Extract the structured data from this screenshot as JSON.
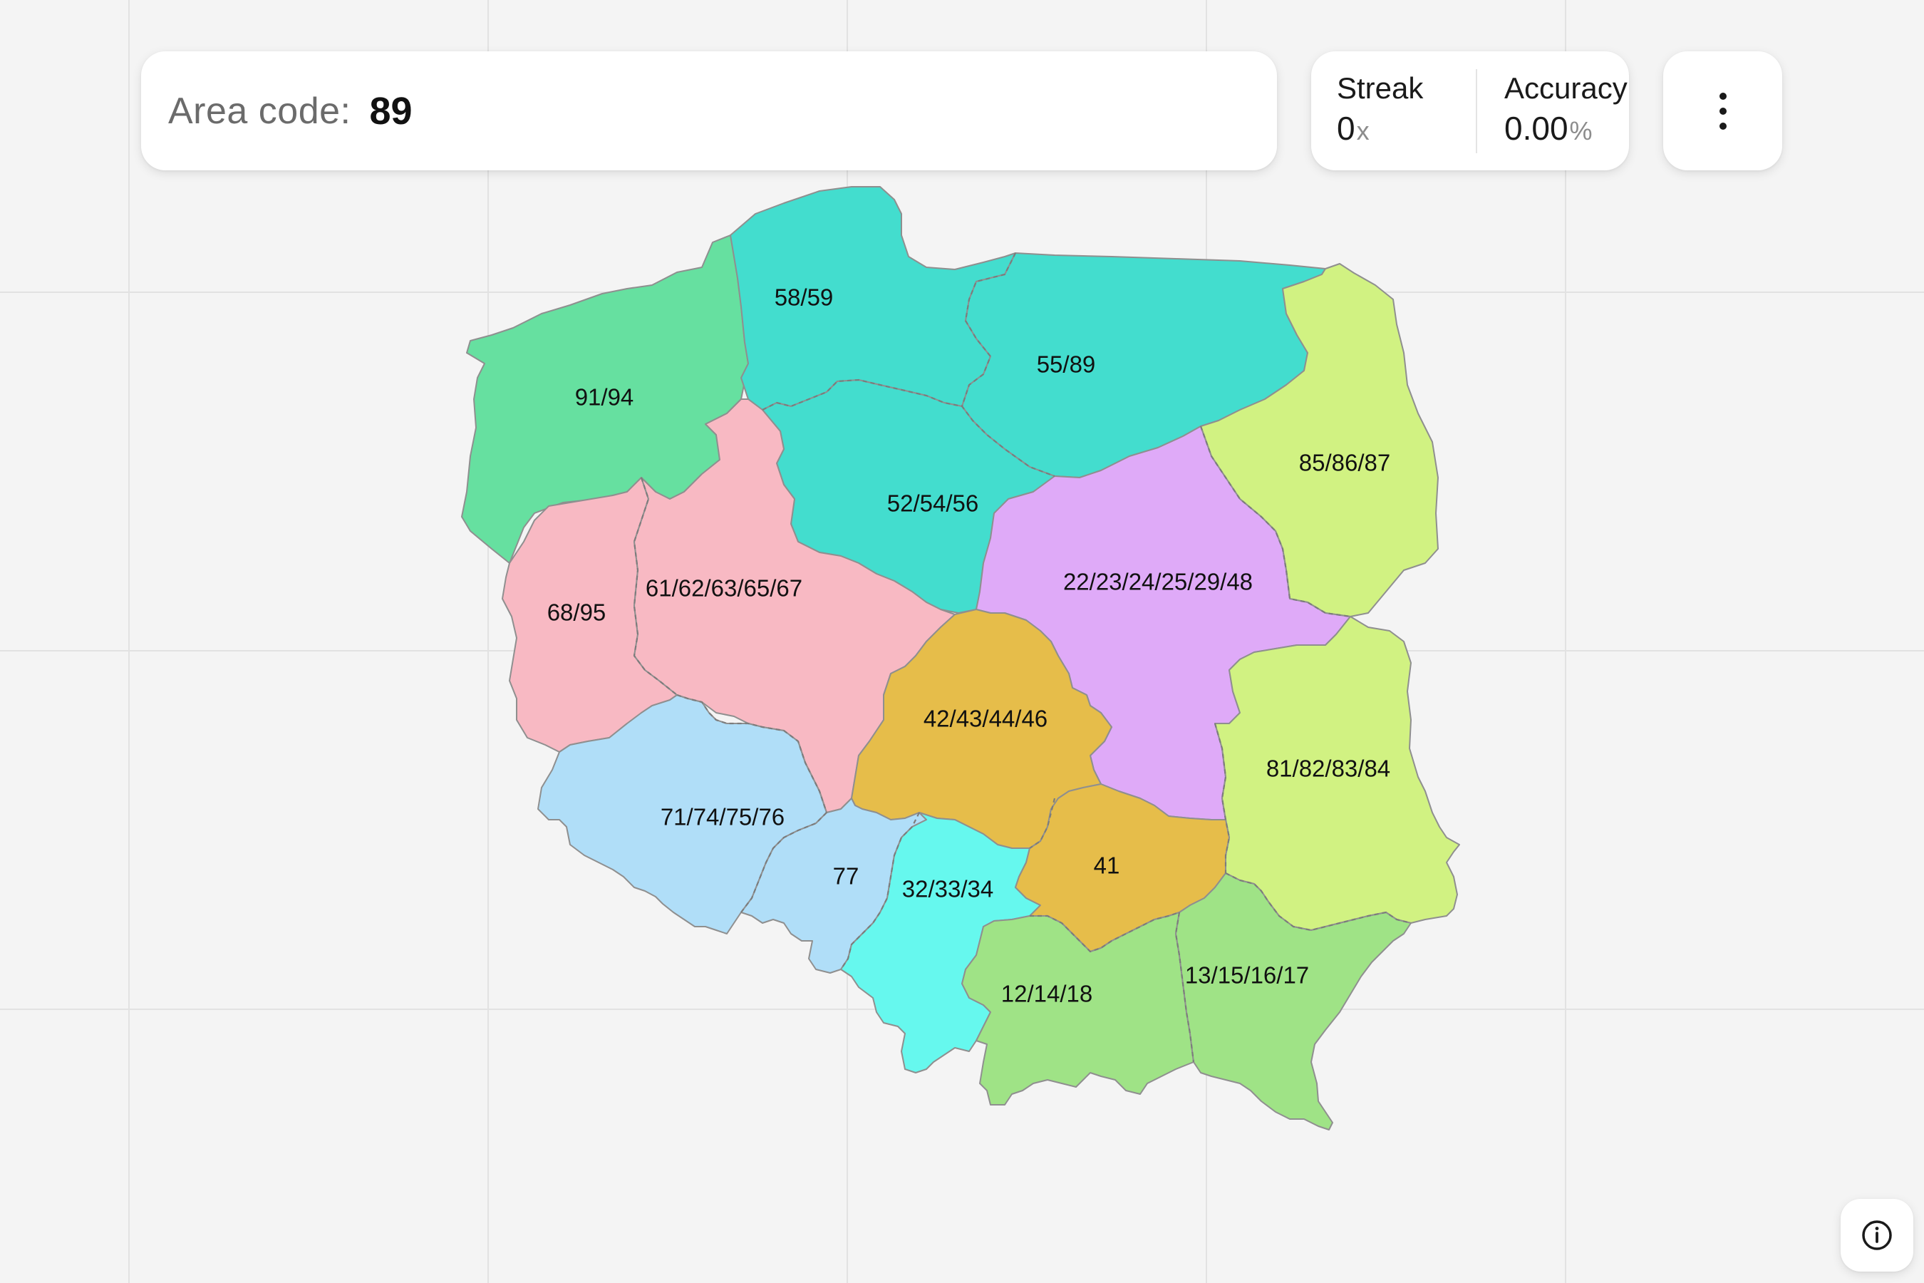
{
  "prompt": {
    "label": "Area code:",
    "value": "89"
  },
  "stats": {
    "streak_label": "Streak",
    "streak_value": "0",
    "streak_unit": "x",
    "accuracy_label": "Accuracy",
    "accuracy_value": "0.00",
    "accuracy_unit": "%"
  },
  "icons": {
    "menu": "more-vertical-icon",
    "info": "info-icon"
  },
  "colors": {
    "background": "#f4f4f4",
    "grid": "#e2e2e2",
    "card": "#ffffff"
  },
  "regions": [
    {
      "id": "91-94",
      "label": "91/94",
      "color": "#66e0a0"
    },
    {
      "id": "58-59",
      "label": "58/59",
      "color": "#43ddce"
    },
    {
      "id": "55-89",
      "label": "55/89",
      "color": "#43ddce"
    },
    {
      "id": "52-54-56",
      "label": "52/54/56",
      "color": "#43ddce"
    },
    {
      "id": "85-86-87",
      "label": "85/86/87",
      "color": "#d1f282"
    },
    {
      "id": "68-95",
      "label": "68/95",
      "color": "#f8b9c3"
    },
    {
      "id": "61-62-63-65-67",
      "label": "61/62/63/65/67",
      "color": "#f8b9c3"
    },
    {
      "id": "22-23-24-25-29-48",
      "label": "22/23/24/25/29/48",
      "color": "#dfaaf8"
    },
    {
      "id": "42-43-44-46",
      "label": "42/43/44/46",
      "color": "#e6bd4a"
    },
    {
      "id": "81-82-83-84",
      "label": "81/82/83/84",
      "color": "#d1f282"
    },
    {
      "id": "71-74-75-76",
      "label": "71/74/75/76",
      "color": "#b0def8"
    },
    {
      "id": "77",
      "label": "77",
      "color": "#b0def8"
    },
    {
      "id": "32-33-34",
      "label": "32/33/34",
      "color": "#66f8ee"
    },
    {
      "id": "41",
      "label": "41",
      "color": "#e6bd4a"
    },
    {
      "id": "12-14-18",
      "label": "12/14/18",
      "color": "#9fe386"
    },
    {
      "id": "13-15-16-17",
      "label": "13/15/16/17",
      "color": "#9fe386"
    }
  ]
}
